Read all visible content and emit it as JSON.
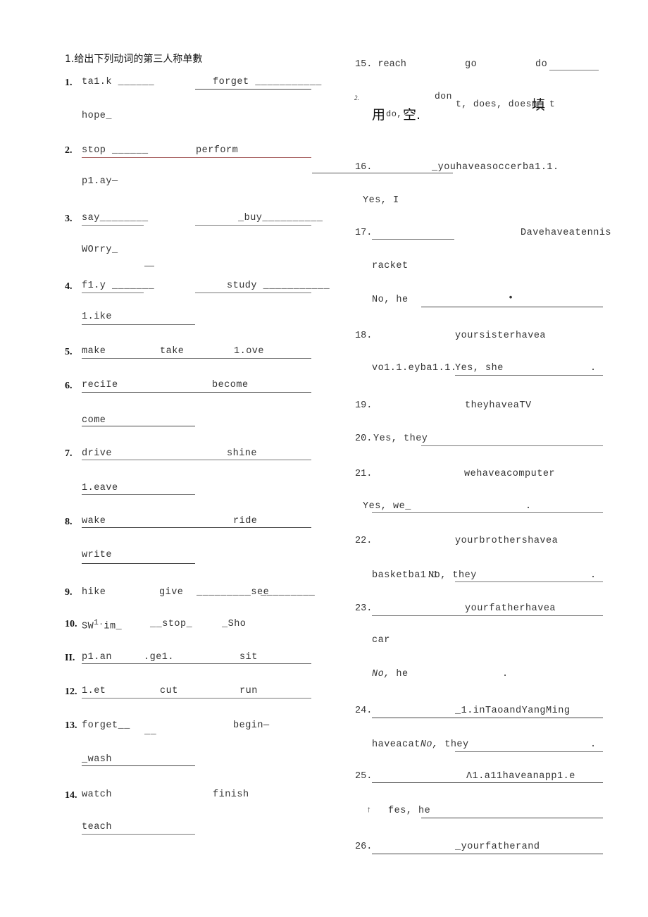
{
  "left": {
    "heading": "1.给出下列动词的第三人称单數",
    "items": [
      {
        "num": "1.",
        "words": [
          "ta1.k ______",
          "forget ___________",
          "hope_"
        ]
      },
      {
        "num": "2.",
        "words": [
          "stop ______",
          "perform",
          "p1.ay—"
        ]
      },
      {
        "num": "3.",
        "words": [
          "say________",
          "_buy__________",
          "WOrry_",
          "—"
        ]
      },
      {
        "num": "4.",
        "words": [
          "f1.y _______",
          "study ___________",
          "1.ike"
        ]
      },
      {
        "num": "5.",
        "words": [
          "make",
          "take",
          "1.ove"
        ]
      },
      {
        "num": "6.",
        "words": [
          "reciIe",
          "become",
          "come"
        ]
      },
      {
        "num": "7.",
        "words": [
          "drive",
          "shine",
          "1.eave"
        ]
      },
      {
        "num": "8.",
        "words": [
          "wake",
          "ride",
          "write"
        ]
      },
      {
        "num": "9.",
        "words": [
          "hike",
          "give",
          "_________see",
          "_________"
        ]
      },
      {
        "num": "10.",
        "words": [
          "SW",
          "1.",
          "im_",
          "__stop_",
          "_Sho"
        ]
      },
      {
        "num": "II.",
        "words": [
          "p1.an",
          ".ge1.",
          "sit"
        ]
      },
      {
        "num": "12.",
        "words": [
          "1.et",
          "cut",
          "run"
        ]
      },
      {
        "num": "13.",
        "words": [
          "forget__",
          "__",
          "begin—",
          "_wash"
        ]
      },
      {
        "num": "14.",
        "words": [
          "watch",
          "finish",
          "teach"
        ]
      }
    ]
  },
  "right": {
    "item15": {
      "text": "15. reach",
      "go": "go",
      "do": "do"
    },
    "section2": {
      "num": "2.",
      "use": "用",
      "do": "do,",
      "kong": "空.",
      "dont": "don",
      "rest": "t, does, doesn’ t",
      "tian": "填"
    },
    "items": [
      {
        "num": "16.",
        "q": "_youhaveasoccerba1.1.",
        "a": "Yes, I"
      },
      {
        "num": "17.",
        "q": "Davehaveatennis",
        "q2": "racket",
        "a": "No, he",
        "dot": "•"
      },
      {
        "num": "18.",
        "q": "yoursisterhavea",
        "q2": "vo1.1.eyba1.1.",
        "a": "Yes, she",
        "end": "."
      },
      {
        "num": "19.",
        "q": "theyhaveaTV"
      },
      {
        "num": "20.",
        "a": "Yes, they"
      },
      {
        "num": "21.",
        "q": "wehaveacomputer",
        "a": "Yes, we_",
        "end": "."
      },
      {
        "num": "22.",
        "q": "yourbrothershavea",
        "q2": "basketba1.1",
        "a": "No, they",
        "end": "."
      },
      {
        "num": "23.",
        "q": "yourfatherhavea",
        "q2": "car",
        "a_italic": "No,",
        "a": " he",
        "end": "."
      },
      {
        "num": "24.",
        "q": "_1.inTaoandYangMing",
        "q2": "haveacat",
        "a_italic": "No,",
        "a": " they",
        "end": "."
      },
      {
        "num": "25.",
        "q": "Λ1.a11haveanapp1.e",
        "arrow": "↑",
        "a": "fes, he"
      },
      {
        "num": "26.",
        "q": "_yourfatherand"
      }
    ]
  }
}
